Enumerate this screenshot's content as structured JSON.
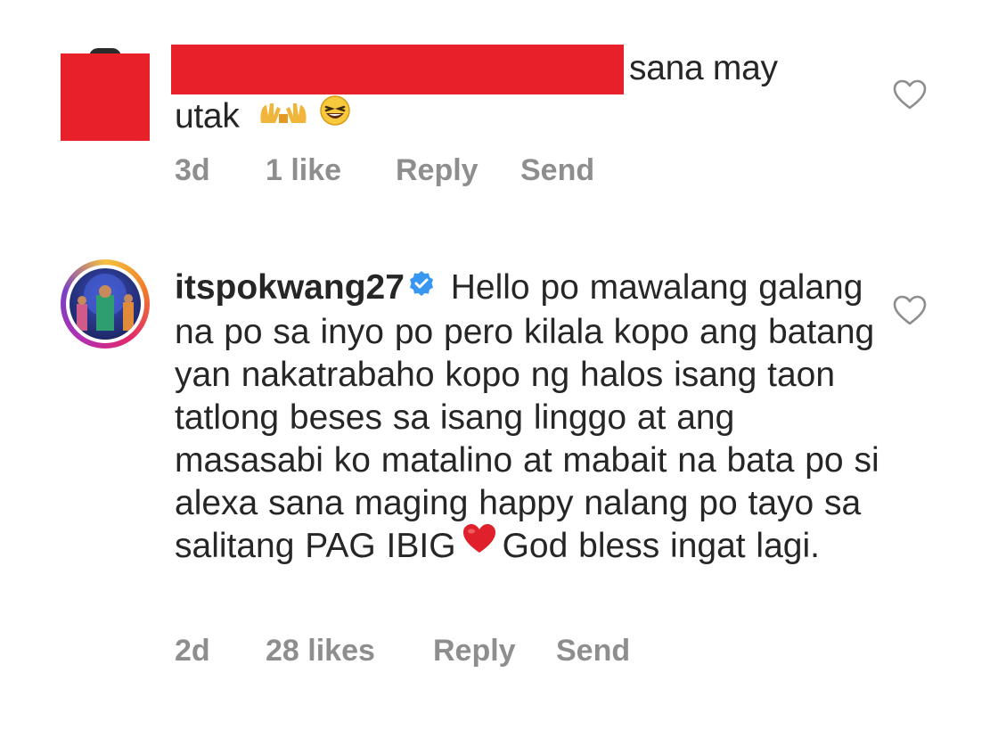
{
  "comment1": {
    "text_line1": "sana may",
    "text_line2": "utak",
    "time": "3d",
    "likes": "1 like",
    "reply": "Reply",
    "send": "Send"
  },
  "comment2": {
    "username": "itspokwang27",
    "text_part1": "Hello po mawalang galang na po sa inyo po pero kilala kopo ang batang yan nakatrabaho kopo ng halos isang taon tatlong beses sa isang linggo at ang masasabi ko matalino at mabait na bata po si alexa sana maging happy nalang po tayo sa salitang PAG IBIG",
    "text_part2": "God bless ingat lagi.",
    "time": "2d",
    "likes": "28 likes",
    "reply": "Reply",
    "send": "Send"
  },
  "colors": {
    "redaction": "#e8202a",
    "text": "#262626",
    "meta": "#8e8e8e",
    "verified": "#3897f0",
    "heart_emoji": "#e0202a"
  },
  "icons": {
    "like": "heart-outline-icon",
    "verified": "verified-badge-icon",
    "emoji1": "raising-hands-emoji",
    "emoji2": "laughing-face-emoji",
    "emoji3": "red-heart-emoji"
  }
}
